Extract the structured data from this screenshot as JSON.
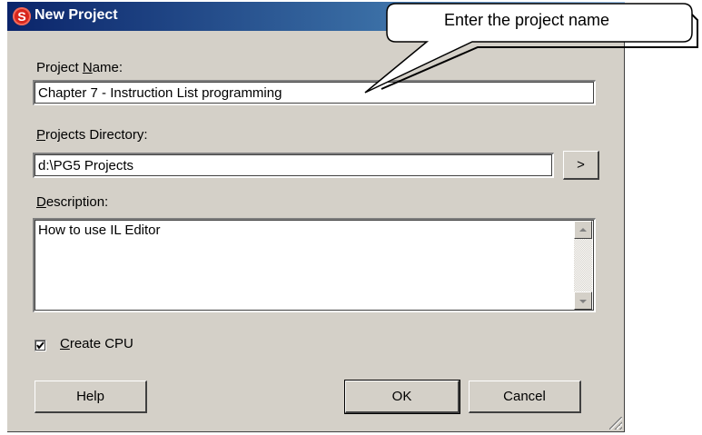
{
  "window": {
    "title": "New Project",
    "app_icon": "saia-pg5-logo-icon"
  },
  "project_name": {
    "label_pre": "Project ",
    "label_accel": "N",
    "label_post": "ame:",
    "value": "Chapter 7 - Instruction List programming"
  },
  "projects_directory": {
    "label_pre": "",
    "label_accel": "P",
    "label_post": "rojects Directory:",
    "value": "d:\\PG5 Projects",
    "browse_label": ">"
  },
  "description": {
    "label_pre": "",
    "label_accel": "D",
    "label_post": "escription:",
    "value": "How to use IL Editor"
  },
  "create_cpu": {
    "label_pre": "",
    "label_accel": "C",
    "label_post": "reate CPU",
    "checked": true
  },
  "buttons": {
    "help": "Help",
    "ok": "OK",
    "cancel": "Cancel"
  },
  "callout": {
    "text": "Enter the project name"
  }
}
